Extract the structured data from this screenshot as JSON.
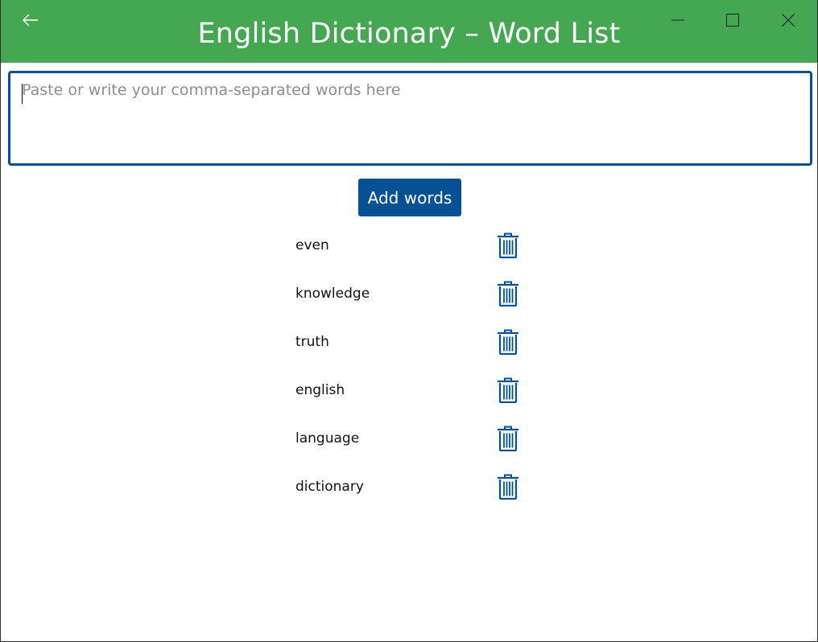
{
  "window": {
    "title": "English Dictionary – Word List",
    "accent_color": "#45a752",
    "primary_color": "#065194"
  },
  "titlebar": {
    "back_icon": "back-arrow-icon",
    "minimize_icon": "minimize-icon",
    "maximize_icon": "maximize-icon",
    "close_icon": "close-icon"
  },
  "input": {
    "placeholder": "Paste or write your comma-separated words here",
    "value": ""
  },
  "actions": {
    "add_label": "Add words"
  },
  "words": [
    {
      "label": "even",
      "delete_icon": "trash-icon"
    },
    {
      "label": "knowledge",
      "delete_icon": "trash-icon"
    },
    {
      "label": "truth",
      "delete_icon": "trash-icon"
    },
    {
      "label": "english",
      "delete_icon": "trash-icon"
    },
    {
      "label": "language",
      "delete_icon": "trash-icon"
    },
    {
      "label": "dictionary",
      "delete_icon": "trash-icon"
    }
  ]
}
